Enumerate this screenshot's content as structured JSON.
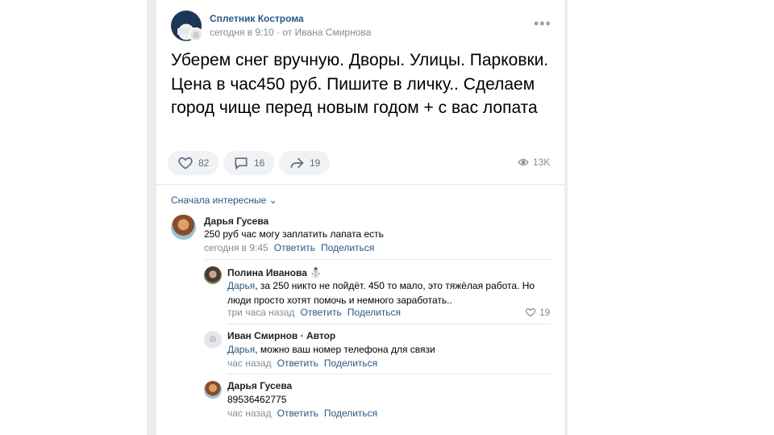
{
  "post": {
    "group_name": "Сплетник Кострома",
    "meta": "сегодня в 9:10 · от Ивана Смирнова",
    "more_label": "•••",
    "text": "Уберем снег вручную. Дворы. Улицы. Парковки. Цена в час450 руб. Пишите в личку.. Сделаем город чище перед новым годом + с вас лопата",
    "likes": "82",
    "comments": "16",
    "shares": "19",
    "views": "13K"
  },
  "sort_label": "Сначала интересные ⌄",
  "comments": [
    {
      "author": "Дарья Гусева",
      "text": "250 руб час могу заплатить лапата есть",
      "time": "сегодня в 9:45",
      "reply": "Ответить",
      "share": "Поделиться"
    },
    {
      "author": "Полина Иванова",
      "mention": "Дарья",
      "text_line1": ", за 250 никто не пойдёт. 450 то мало, это тяжёлая работа. Но",
      "text_line2": "люди просто хотят помочь и немного заработать..",
      "time": "три часа назад",
      "reply": "Ответить",
      "share": "Поделиться",
      "likes": "19"
    },
    {
      "author": "Иван Смирнов · Автор",
      "mention": "Дарья",
      "text": ", можно ваш номер телефона для связи",
      "time": "час назад",
      "reply": "Ответить",
      "share": "Поделиться"
    },
    {
      "author": "Дарья Гусева",
      "text": "89536462775",
      "time": "час назад",
      "reply": "Ответить",
      "share": "Поделиться"
    }
  ],
  "icons": {
    "like": "heart-icon",
    "comment": "comment-icon",
    "share": "share-arrow-icon",
    "views": "eye-icon",
    "more": "more-dots-icon"
  },
  "colors": {
    "link": "#2a5885",
    "muted": "#818c99",
    "pill_bg": "#f0f2f5"
  }
}
